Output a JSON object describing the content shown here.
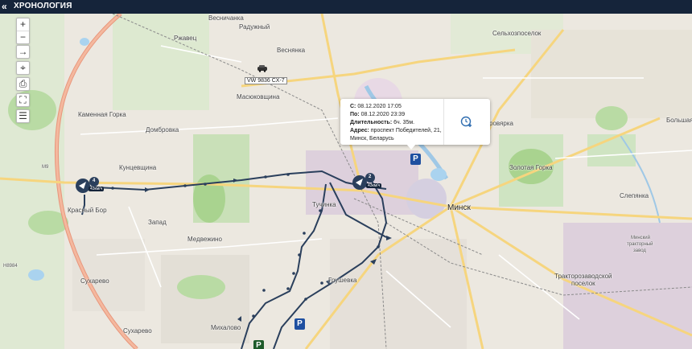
{
  "header": {
    "collapse_icon": "«",
    "title": "ХРОНОЛОГИЯ"
  },
  "map_controls": {
    "zoom_in": "+",
    "zoom_out": "−",
    "arrow": "→",
    "locate": "⌖",
    "print": "⎙",
    "fullscreen": "⛶",
    "list": "☰"
  },
  "vehicle_plate": "VW 9836 CX-7",
  "popup": {
    "from_label": "С:",
    "from_value": "08.12.2020 17:05",
    "to_label": "По:",
    "to_value": "08.12.2020 23:39",
    "duration_label": "Длительность:",
    "duration_value": "6ч. 35м.",
    "address_label": "Адрес:",
    "address_value": "проспект Победителей, 21, Минск, Беларусь",
    "action_icon": "add-time-icon"
  },
  "markers": [
    {
      "count": "4",
      "speed": "43км/ч"
    },
    {
      "count": "2",
      "speed": "43км/ч"
    }
  ],
  "parking_label": "P",
  "place_labels": {
    "veсhnyanka_north": "Весничанка",
    "raduzhny": "Радужный",
    "rzhavets": "Ржавец",
    "vesnyanka": "Веснянка",
    "masyukovshchina": "Масюковщина",
    "kamennaya_gorka": "Каменная Горка",
    "dombrovka": "Домбровка",
    "kuntsevshchina": "Кунцевщина",
    "krasny_bor": "Красный Бор",
    "zapad": "Запад",
    "medvezhino": "Медвежино",
    "tuchinka": "Тучинка",
    "grushevka": "Грушевка",
    "sukharevo_w": "Сухарево",
    "sukharevo_s": "Сухарево",
    "mikhalovo": "Михалово",
    "minsk": "Минск",
    "selkhozposelok": "Сельхозпоселок",
    "zolotaya_gorka": "Золотая Горка",
    "bolshaya": "Большая",
    "slepyanka": "Слепянка",
    "traktorozavodskoy": "Тракторозаводской",
    "poselok": "поселок",
    "minsk_tractor_1": "Минский",
    "minsk_tractor_2": "тракторный",
    "minsk_tractor_3": "завод",
    "orovarka": "ровярка",
    "m9": "M9",
    "h8984": "H8984"
  },
  "colors": {
    "route": "#2a3f5c",
    "header_bg": "#15243a",
    "parking_blue": "#1e4fa0",
    "parking_green": "#1e5b2a"
  }
}
